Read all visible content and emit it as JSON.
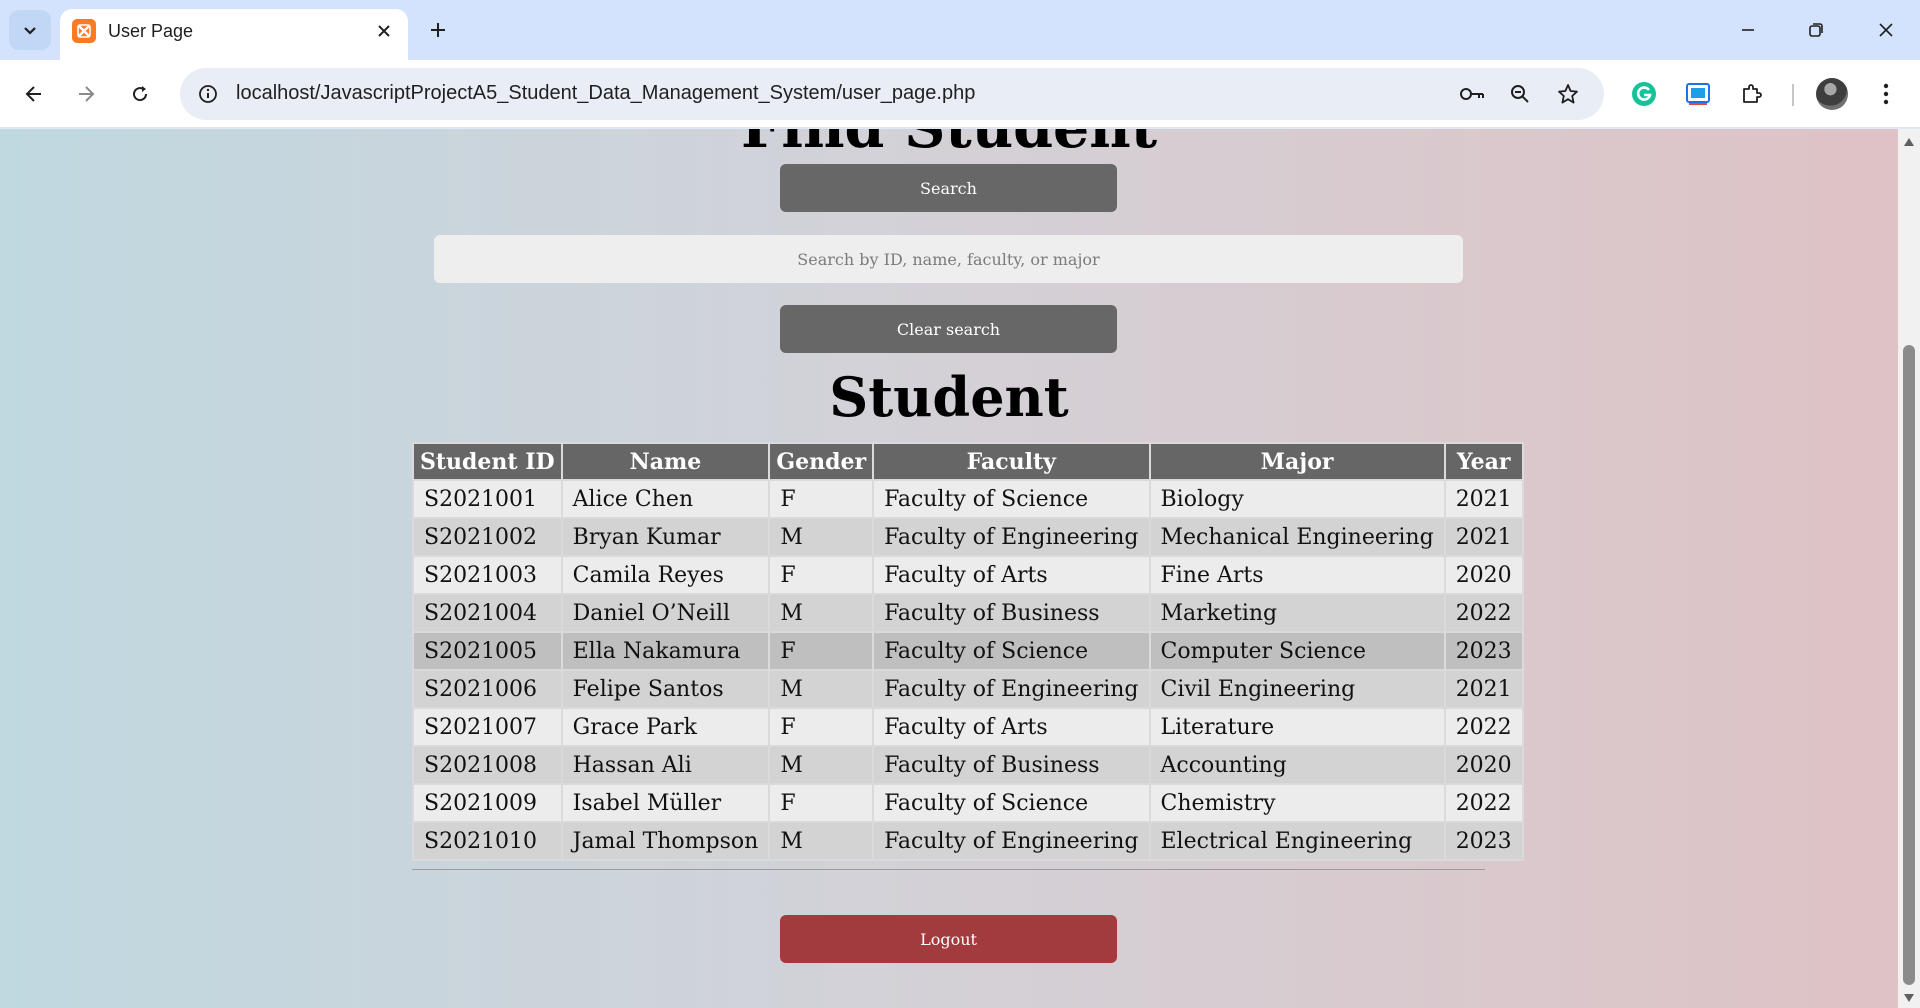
{
  "browser": {
    "tab_title": "User Page",
    "url": "localhost/JavascriptProjectA5_Student_Data_Management_System/user_page.php",
    "icons": [
      "tab-search-icon",
      "xampp-favicon-icon",
      "close-icon",
      "plus-icon",
      "minimize-icon",
      "restore-icon",
      "back-icon",
      "forward-icon",
      "reload-icon",
      "site-info-icon",
      "key-icon",
      "zoom-icon",
      "star-icon",
      "grammarly-icon",
      "screen-capture-icon",
      "puzzle-icon",
      "kebab-menu-icon"
    ]
  },
  "page": {
    "find_heading": "Find Student",
    "search_button": "Search",
    "search_placeholder": "Search by ID, name, faculty, or major",
    "clear_button": "Clear search",
    "student_heading": "Student",
    "logout_button": "Logout",
    "colors": {
      "button": "#676767",
      "logout": "#a13b3e",
      "header": "#666666"
    }
  },
  "table": {
    "headers": [
      "Student ID",
      "Name",
      "Gender",
      "Faculty",
      "Major",
      "Year"
    ],
    "rows": [
      [
        "S2021001",
        "Alice Chen",
        "F",
        "Faculty of Science",
        "Biology",
        "2021"
      ],
      [
        "S2021002",
        "Bryan Kumar",
        "M",
        "Faculty of Engineering",
        "Mechanical Engineering",
        "2021"
      ],
      [
        "S2021003",
        "Camila Reyes",
        "F",
        "Faculty of Arts",
        "Fine Arts",
        "2020"
      ],
      [
        "S2021004",
        "Daniel O’Neill",
        "M",
        "Faculty of Business",
        "Marketing",
        "2022"
      ],
      [
        "S2021005",
        "Ella Nakamura",
        "F",
        "Faculty of Science",
        "Computer Science",
        "2023"
      ],
      [
        "S2021006",
        "Felipe Santos",
        "M",
        "Faculty of Engineering",
        "Civil Engineering",
        "2021"
      ],
      [
        "S2021007",
        "Grace Park",
        "F",
        "Faculty of Arts",
        "Literature",
        "2022"
      ],
      [
        "S2021008",
        "Hassan Ali",
        "M",
        "Faculty of Business",
        "Accounting",
        "2020"
      ],
      [
        "S2021009",
        "Isabel Müller",
        "F",
        "Faculty of Science",
        "Chemistry",
        "2022"
      ],
      [
        "S2021010",
        "Jamal Thompson",
        "M",
        "Faculty of Engineering",
        "Electrical Engineering",
        "2023"
      ]
    ]
  }
}
